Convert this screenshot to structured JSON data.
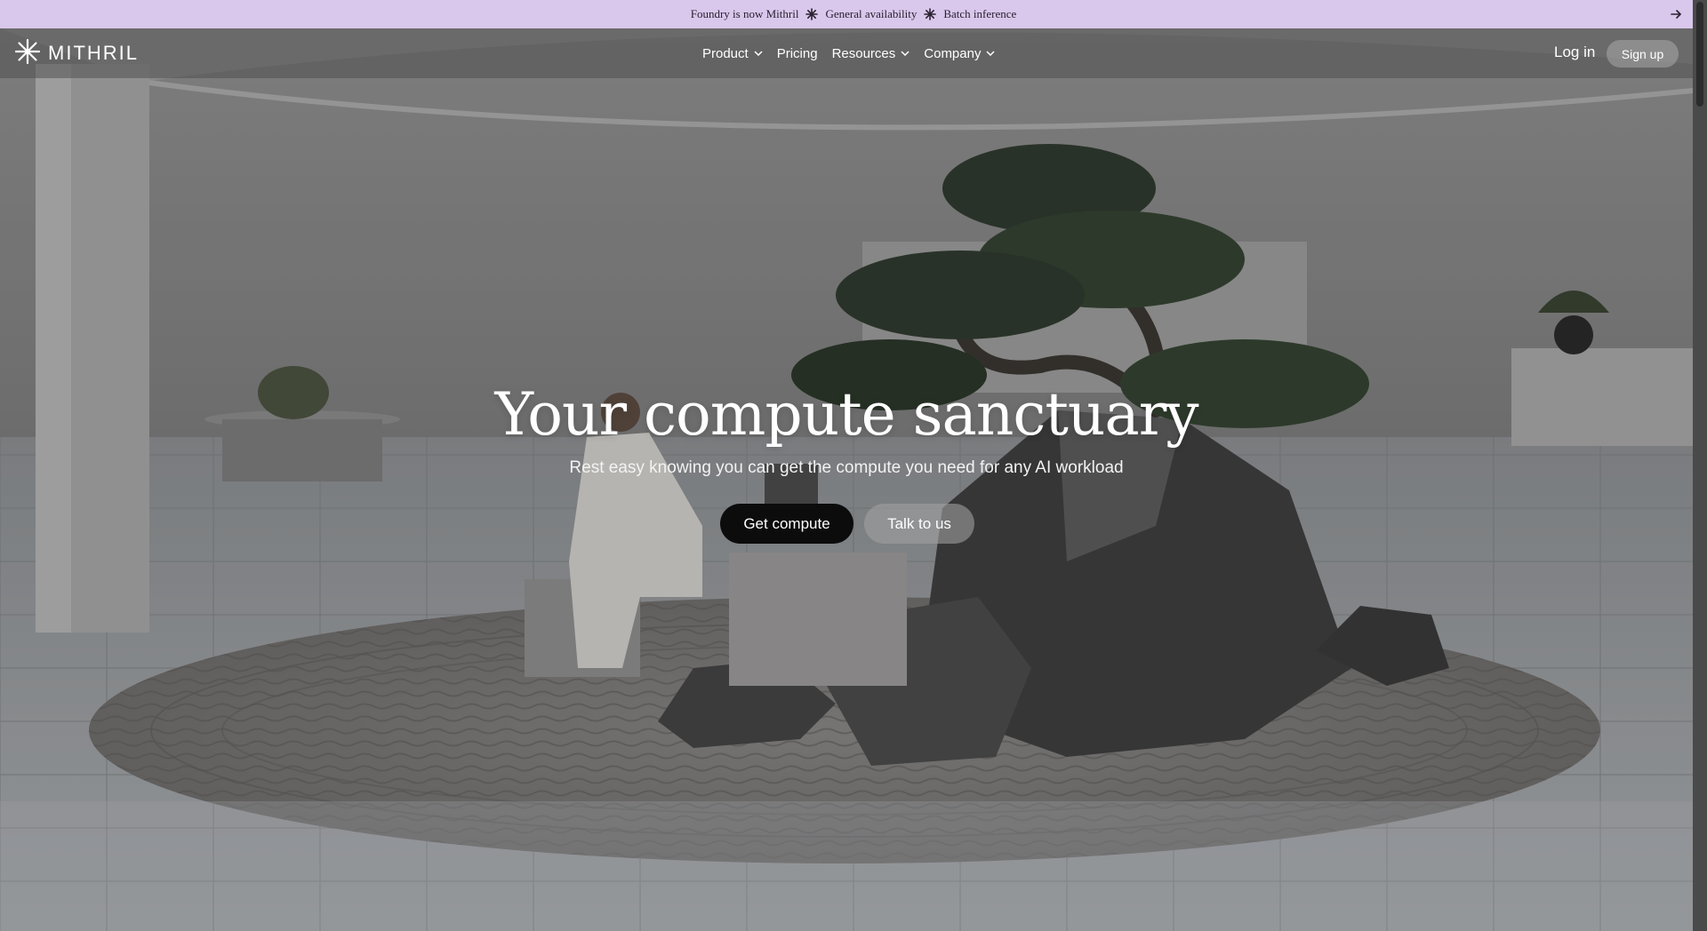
{
  "announcement": {
    "items": [
      "Foundry is now Mithril",
      "General availability",
      "Batch inference"
    ],
    "separator_icon": "asterisk-icon",
    "arrow_icon": "arrow-right-icon",
    "background": "#d9c7ec"
  },
  "nav": {
    "logo_text": "MITHRIL",
    "logo_icon": "starburst-icon",
    "links": [
      {
        "label": "Product",
        "has_dropdown": true
      },
      {
        "label": "Pricing",
        "has_dropdown": false
      },
      {
        "label": "Resources",
        "has_dropdown": true
      },
      {
        "label": "Company",
        "has_dropdown": true
      }
    ],
    "login_label": "Log in",
    "signup_label": "Sign up"
  },
  "hero": {
    "title": "Your compute sanctuary",
    "subtitle": "Rest easy knowing you can get the compute you need for any AI workload",
    "primary_cta": "Get compute",
    "secondary_cta": "Talk to us",
    "background_image": "zen-garden-office-photo"
  }
}
